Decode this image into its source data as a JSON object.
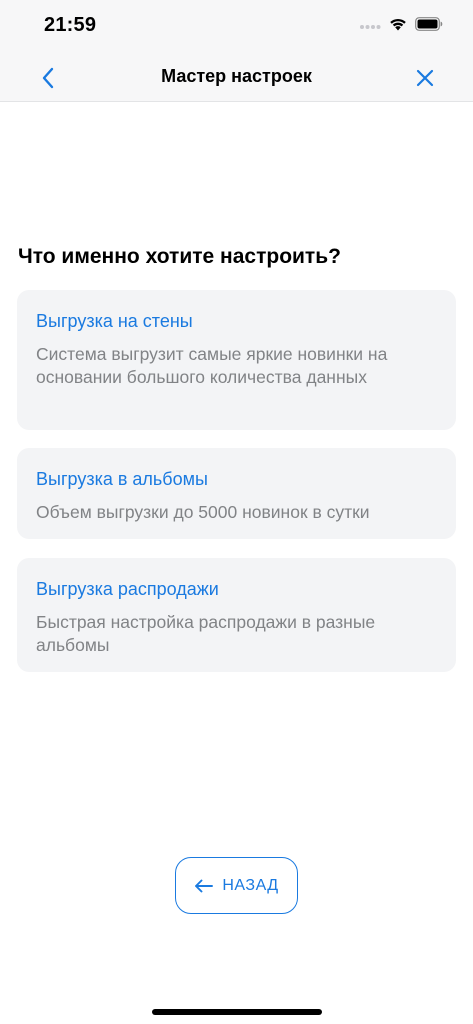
{
  "status_bar": {
    "time": "21:59"
  },
  "nav": {
    "title": "Мастер настроек"
  },
  "question": "Что именно хотите настроить?",
  "options": [
    {
      "title": "Выгрузка на стены",
      "description": "Система выгрузит самые яркие новинки на основании большого количества данных"
    },
    {
      "title": "Выгрузка в альбомы",
      "description": "Объем выгрузки до 5000 новинок в сутки"
    },
    {
      "title": "Выгрузка распродажи",
      "description": "Быстрая настройка распродажи в разные альбомы"
    }
  ],
  "back_button": {
    "label": "НАЗАД"
  },
  "colors": {
    "accent": "#1a7ae0",
    "card_bg": "#f3f4f6",
    "secondary_text": "#818386"
  }
}
